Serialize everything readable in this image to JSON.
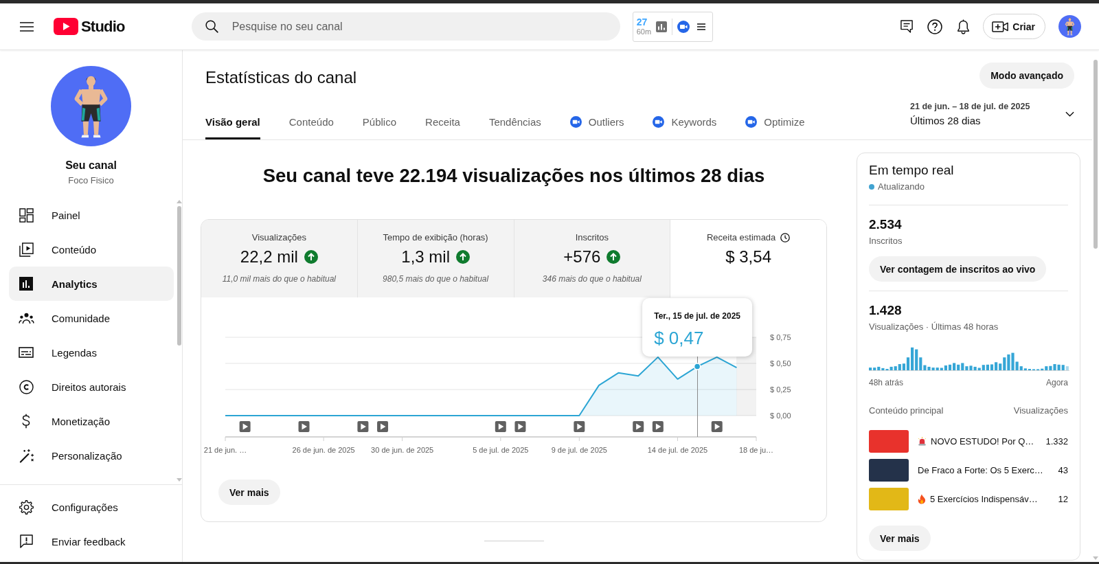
{
  "top_bar": {
    "logo_text": "Studio",
    "search": {
      "placeholder": "Pesquise no seu canal"
    },
    "extension_widget": {
      "count": "27",
      "duration": "60m"
    },
    "create_button": "Criar"
  },
  "sidebar": {
    "channel": {
      "title": "Seu canal",
      "name": "Foco Fisico"
    },
    "items": [
      {
        "label": "Painel",
        "selected": false
      },
      {
        "label": "Conteúdo",
        "selected": false
      },
      {
        "label": "Analytics",
        "selected": true
      },
      {
        "label": "Comunidade",
        "selected": false
      },
      {
        "label": "Legendas",
        "selected": false
      },
      {
        "label": "Direitos autorais",
        "selected": false
      },
      {
        "label": "Monetização",
        "selected": false
      },
      {
        "label": "Personalização",
        "selected": false
      }
    ],
    "footer_items": [
      {
        "label": "Configurações"
      },
      {
        "label": "Enviar feedback"
      }
    ]
  },
  "header": {
    "title": "Estatísticas do canal",
    "advanced_button": "Modo avançado",
    "tabs": [
      {
        "label": "Visão geral",
        "kind": "native",
        "selected": true
      },
      {
        "label": "Conteúdo",
        "kind": "native",
        "selected": false
      },
      {
        "label": "Público",
        "kind": "native",
        "selected": false
      },
      {
        "label": "Receita",
        "kind": "native",
        "selected": false
      },
      {
        "label": "Tendências",
        "kind": "native",
        "selected": false
      },
      {
        "label": "Outliers",
        "kind": "extension",
        "selected": false
      },
      {
        "label": "Keywords",
        "kind": "extension",
        "selected": false
      },
      {
        "label": "Optimize",
        "kind": "extension",
        "selected": false
      }
    ],
    "date_range": {
      "range": "21 de jun. – 18 de jul. de 2025",
      "preset": "Últimos 28 dias"
    }
  },
  "overview": {
    "headline": "Seu canal teve 22.194 visualizações nos últimos 28 dias",
    "metrics": [
      {
        "label": "Visualizações",
        "value": "22,2 mil",
        "increased": true,
        "comparison": "11,0 mil mais do que o habitual",
        "delayed": false,
        "selected": false
      },
      {
        "label": "Tempo de exibição (horas)",
        "value": "1,3 mil",
        "increased": true,
        "comparison": "980,5 mais do que o habitual",
        "delayed": false,
        "selected": false
      },
      {
        "label": "Inscritos",
        "value": "+576",
        "increased": true,
        "comparison": "346 mais do que o habitual",
        "delayed": false,
        "selected": false
      },
      {
        "label": "Receita estimada",
        "value": "$ 3,54",
        "increased": false,
        "delayed": true,
        "selected": true
      }
    ],
    "chart_data": {
      "type": "area",
      "categories": [
        "21 de jun. …",
        null,
        null,
        null,
        null,
        "26 de jun. de 2025",
        null,
        null,
        null,
        "30 de jun. de 2025",
        null,
        null,
        null,
        null,
        "5 de jul. de 2025",
        null,
        null,
        null,
        "9 de jul. de 2025",
        null,
        null,
        null,
        null,
        "14 de jul. de 2025",
        null,
        null,
        null,
        "18 de ju…"
      ],
      "series": [
        {
          "color": "#2ba5d4",
          "values": [
            0,
            0,
            0,
            0,
            0,
            0,
            0,
            0,
            0,
            0,
            0,
            0,
            0,
            0,
            0,
            0,
            0,
            0,
            0,
            0.29,
            0.41,
            0.38,
            0.56,
            0.35,
            0.47,
            0.56,
            0.46,
            null
          ]
        }
      ],
      "ylim": [
        0,
        0.75
      ],
      "yticks": [
        {
          "value": 0,
          "label": "$ 0,00"
        },
        {
          "value": 0.25,
          "label": "$ 0,25"
        },
        {
          "value": 0.5,
          "label": "$ 0,50"
        },
        {
          "value": 0.75,
          "label": "$ 0,75"
        }
      ],
      "annotations": [
        {
          "y": 0.47,
          "text": "**Ter., 15 de jul. de 2025**\n$ 0,47"
        }
      ]
    },
    "button": "Ver mais"
  },
  "realtime": {
    "title": "Em tempo real",
    "status": "Atualizando",
    "subscribers": {
      "value": "2.534",
      "label": "Inscritos",
      "button": "Ver contagem de inscritos ao vivo"
    },
    "views": {
      "value": "1.428",
      "label": "Visualizações · Últimas 48 horas",
      "start_label": "48h atrás",
      "end_label": "Agora"
    },
    "top_content": {
      "columns": [
        "Conteúdo principal",
        "Visualizações"
      ],
      "rows": [
        {
          "kind": "alert",
          "title": "NOVO ESTUDO! Por Q…",
          "views": "1.332",
          "color": "#e8322c"
        },
        {
          "kind": "plain",
          "title": "De Fraco a Forte: Os 5 Exerc…",
          "views": "43",
          "color": "#24324a"
        },
        {
          "kind": "trending",
          "title": "5 Exercícios Indispensáv…",
          "views": "12",
          "color": "#e2b817"
        }
      ]
    },
    "button": "Ver mais"
  }
}
